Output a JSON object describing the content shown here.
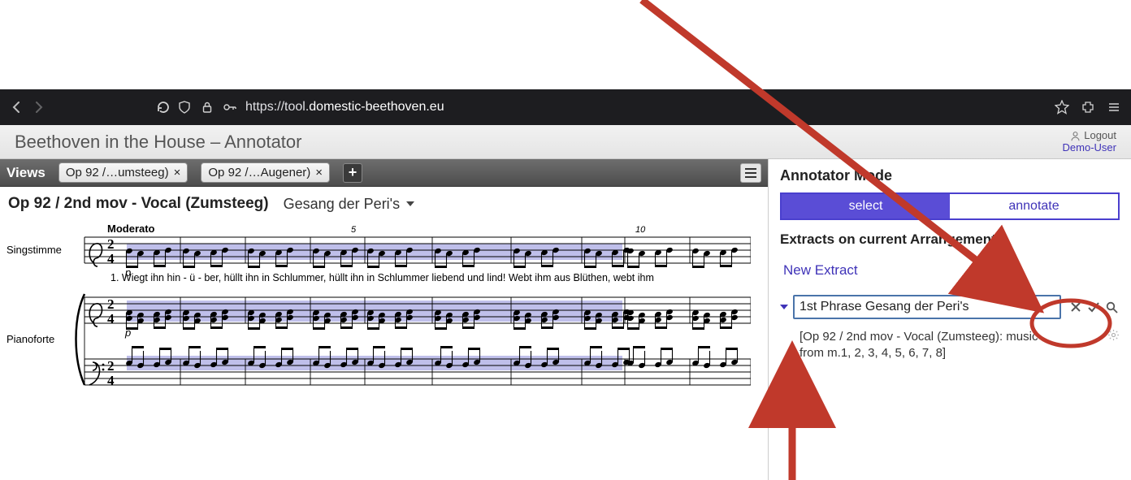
{
  "browser": {
    "url_prefix": "https://tool.",
    "url_domain": "domestic-beethoven.eu",
    "url_suffix": ""
  },
  "header": {
    "title": "Beethoven in the House – Annotator",
    "logout": "Logout",
    "user": "Demo-User"
  },
  "tabbar": {
    "views_label": "Views",
    "tabs": [
      {
        "label": "Op 92 /…umsteeg)"
      },
      {
        "label": "Op 92 /…Augener)"
      }
    ]
  },
  "score": {
    "title": "Op 92 / 2nd mov - Vocal (Zumsteeg)",
    "subtitle": "Gesang der Peri's",
    "tempo": "Moderato",
    "time_sig": "2/4",
    "bar_numbers": [
      "5",
      "10"
    ],
    "instruments": [
      "Singstimme",
      "Pianoforte"
    ],
    "dynamic": "p",
    "lyrics": "1. Wiegt ihn hin - ü - ber, hüllt ihn in Schlummer, hüllt ihn in   Schlummer liebend und lind!    Webt ihm aus Blüthen,   webt ihm"
  },
  "panel": {
    "mode_label": "Annotator Mode",
    "select_label": "select",
    "annotate_label": "annotate",
    "extracts_label": "Extracts on current Arrangements:",
    "new_extract": "New Extract",
    "input_value": "1st Phrase Gesang der Peri's",
    "detail": "[Op 92 / 2nd mov - Vocal (Zumsteeg): music from m.1, 2, 3, 4, 5, 6, 7, 8]"
  }
}
